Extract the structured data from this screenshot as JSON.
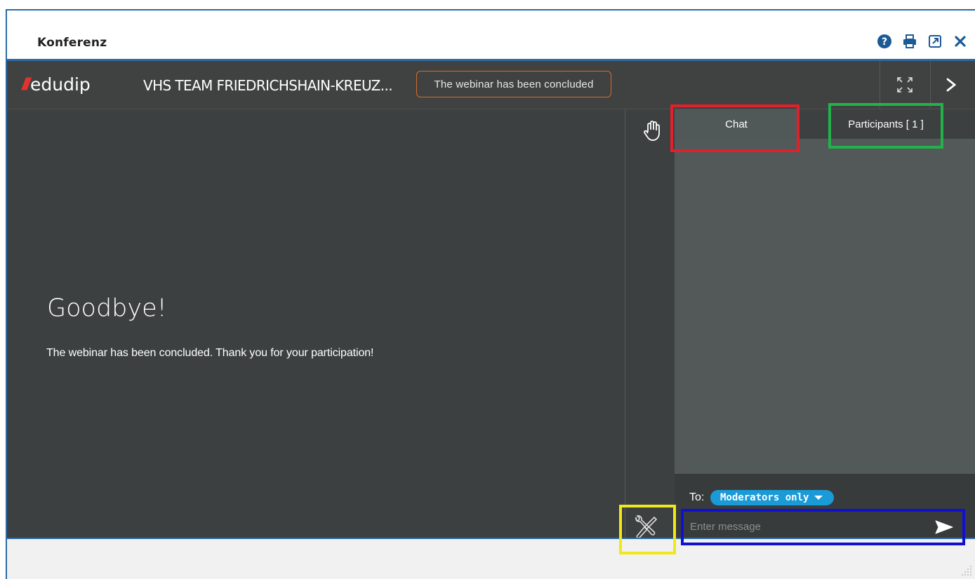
{
  "window": {
    "title": "Konferenz",
    "icons": [
      "help-icon",
      "print-icon",
      "external-link-icon",
      "close-icon"
    ]
  },
  "header": {
    "logo_text": "edudip",
    "webinar_title": "VHS TEAM FRIEDRICHSHAIN-KREUZ...",
    "status": "The webinar has been concluded",
    "status_border_color": "#d96a2a"
  },
  "stage": {
    "heading": "Goodbye!",
    "message": "The webinar has been concluded. Thank you for your participation!"
  },
  "panel": {
    "tabs": [
      {
        "label": "Chat",
        "active": true
      },
      {
        "label": "Participants [ 1 ]",
        "active": false
      }
    ],
    "to_label": "To:",
    "recipient": "Moderators only",
    "message_placeholder": "Enter message"
  },
  "highlights": {
    "chat_tab": "#e0202a",
    "participants_tab": "#22b24a",
    "tools_button": "#f0e81a",
    "message_input": "#1010d0"
  },
  "colors": {
    "accent_blue": "#2a6aa8",
    "stage_bg": "#3c4040",
    "recipient_pill": "#1a9ad6"
  }
}
